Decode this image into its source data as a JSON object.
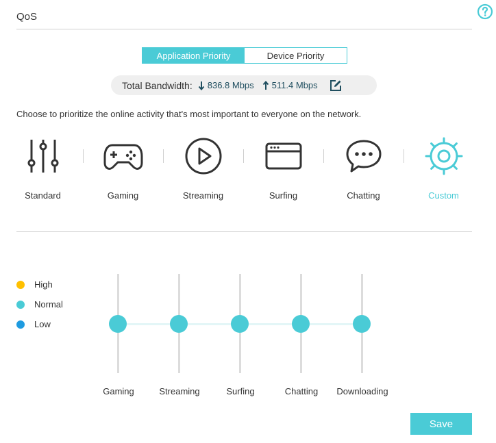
{
  "header": {
    "title": "QoS",
    "help_icon": "question-circle-icon"
  },
  "tabs": [
    {
      "label": "Application Priority",
      "active": true
    },
    {
      "label": "Device Priority",
      "active": false
    }
  ],
  "bandwidth": {
    "label": "Total Bandwidth:",
    "download": "836.8 Mbps",
    "upload": "511.4 Mbps",
    "download_icon": "arrow-down-icon",
    "upload_icon": "arrow-up-icon",
    "edit_icon": "edit-icon"
  },
  "intro_text": "Choose to prioritize the online activity that's most important to everyone on the network.",
  "modes": [
    {
      "label": "Standard",
      "icon": "sliders-icon",
      "selected": false
    },
    {
      "label": "Gaming",
      "icon": "gamepad-icon",
      "selected": false
    },
    {
      "label": "Streaming",
      "icon": "play-circle-icon",
      "selected": false
    },
    {
      "label": "Surfing",
      "icon": "browser-window-icon",
      "selected": false
    },
    {
      "label": "Chatting",
      "icon": "chat-bubble-icon",
      "selected": false
    },
    {
      "label": "Custom",
      "icon": "custom-gear-icon",
      "selected": true
    }
  ],
  "legend": [
    {
      "label": "High",
      "color": "#ffc000"
    },
    {
      "label": "Normal",
      "color": "#4acbd6"
    },
    {
      "label": "Low",
      "color": "#1e9be0"
    }
  ],
  "priorities": [
    {
      "label": "Gaming",
      "level": "Normal"
    },
    {
      "label": "Streaming",
      "level": "Normal"
    },
    {
      "label": "Surfing",
      "level": "Normal"
    },
    {
      "label": "Chatting",
      "level": "Normal"
    },
    {
      "label": "Downloading",
      "level": "Normal"
    }
  ],
  "save_label": "Save",
  "colors": {
    "accent": "#4acbd6",
    "dark_text": "#333333",
    "bandwidth_value": "#1f4e5f"
  }
}
